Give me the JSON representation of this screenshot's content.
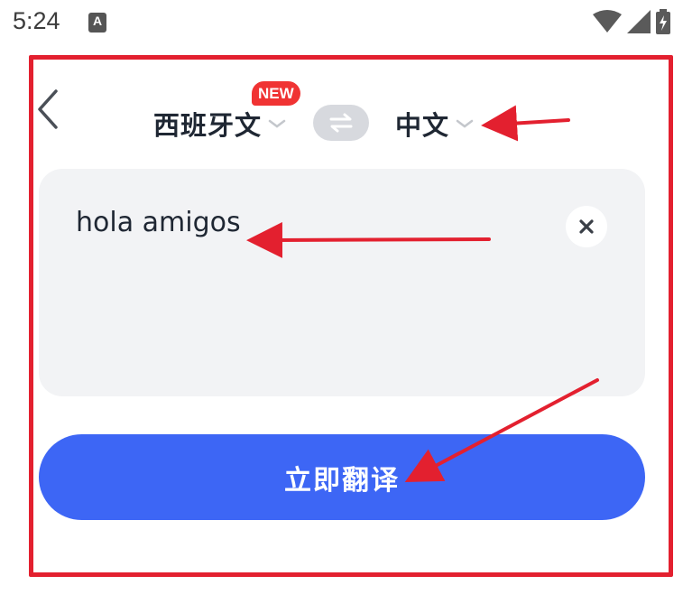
{
  "status_bar": {
    "time": "5:24",
    "app_icon_letter": "A"
  },
  "header": {
    "source_language": "西班牙文",
    "source_badge": "NEW",
    "target_language": "中文"
  },
  "input": {
    "value": "hola amigos"
  },
  "translate_button": {
    "label": "立即翻译"
  },
  "colors": {
    "primary": "#3d66f5",
    "badge": "#f03333",
    "annotation": "#e3202f",
    "card_bg": "#f2f3f5",
    "text": "#1f2733"
  },
  "icons": {
    "back": "chevron-left-icon",
    "swap": "swap-icon",
    "dropdown": "chevron-down-icon",
    "clear": "close-icon",
    "wifi": "wifi-icon",
    "signal": "cell-signal-icon",
    "battery": "battery-charging-icon"
  }
}
